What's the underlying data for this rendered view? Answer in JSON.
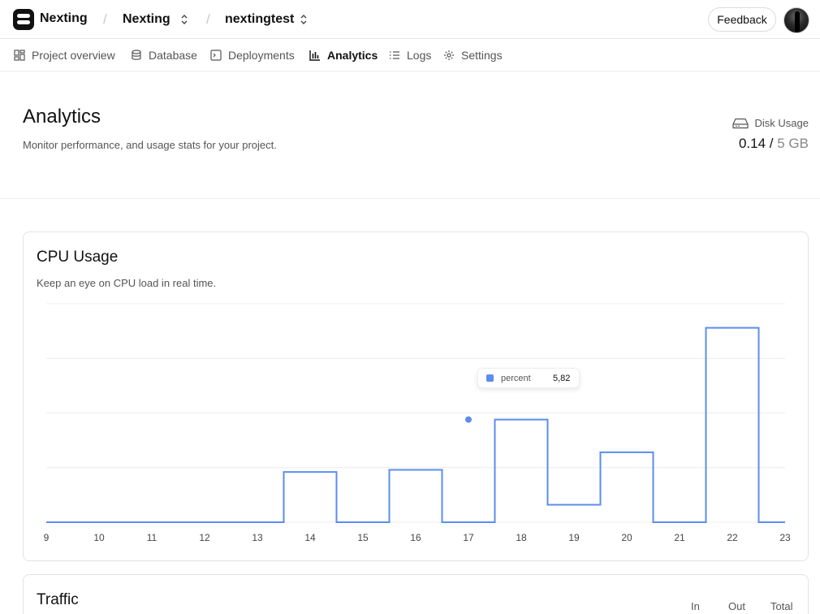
{
  "app": {
    "brand": "Nexting"
  },
  "breadcrumb": {
    "org": "Nexting",
    "project": "nextingtest"
  },
  "header": {
    "feedback_label": "Feedback"
  },
  "nav": {
    "items": [
      {
        "label": "Project overview",
        "icon": "grid-icon",
        "active": false
      },
      {
        "label": "Database",
        "icon": "database-icon",
        "active": false
      },
      {
        "label": "Deployments",
        "icon": "terminal-icon",
        "active": false
      },
      {
        "label": "Analytics",
        "icon": "bar-chart-icon",
        "active": true
      },
      {
        "label": "Logs",
        "icon": "list-icon",
        "active": false
      },
      {
        "label": "Settings",
        "icon": "gear-icon",
        "active": false
      }
    ]
  },
  "page": {
    "title": "Analytics",
    "subtitle": "Monitor performance, and usage stats for your project.",
    "disk": {
      "label": "Disk Usage",
      "used": "0.14",
      "divider": "/",
      "total": "5 GB"
    }
  },
  "cpu_card": {
    "title": "CPU Usage",
    "subtitle": "Keep an eye on CPU load in real time.",
    "tooltip": {
      "name": "percent",
      "value": "5,82"
    }
  },
  "traffic_card": {
    "title": "Traffic",
    "columns": [
      "In",
      "Out",
      "Total"
    ]
  },
  "colors": {
    "line": "#5b8def",
    "grid": "#ececec"
  },
  "chart_data": {
    "type": "line",
    "step": true,
    "x": [
      9,
      10,
      11,
      12,
      13,
      14,
      15,
      16,
      17,
      18,
      19,
      20,
      21,
      22,
      23
    ],
    "series": [
      {
        "name": "percent",
        "values": [
          0,
          0,
          0,
          0,
          0,
          2.3,
          0,
          2.4,
          0,
          4.7,
          0.8,
          3.2,
          0,
          8.9,
          0
        ]
      }
    ],
    "highlight": {
      "x": 17,
      "y": 4.7,
      "label": "5,82"
    },
    "ylim": [
      0,
      10
    ],
    "grid": true
  }
}
